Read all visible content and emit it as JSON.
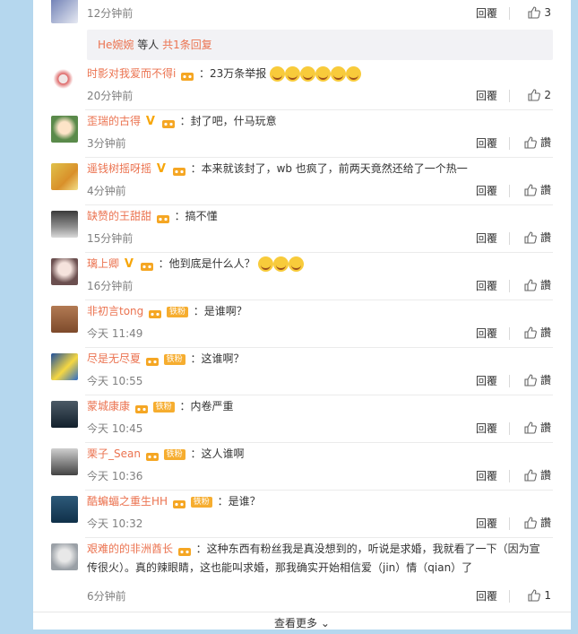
{
  "top_comment": {
    "time": "12分钟前",
    "reply": "回覆",
    "likes": "3"
  },
  "reply_box": {
    "user": "He婉婉",
    "text": " 等人 ",
    "count": "共1条回复"
  },
  "comments": [
    {
      "user": "时影对我爱而不得i",
      "text": "：23万条举报",
      "time": "20分钟前",
      "reply": "回覆",
      "likes": "2",
      "vip": false,
      "fan": false,
      "emojis": 6
    },
    {
      "user": "歪瑞的古得",
      "text": "：封了吧，什马玩意",
      "time": "3分钟前",
      "reply": "回覆",
      "likes": "讚",
      "vip": true,
      "fan": false,
      "emojis": 0
    },
    {
      "user": "遥钱树摇呀摇",
      "text": "：本来就该封了，wb 也疯了，前两天竟然还给了一个热一",
      "time": "4分钟前",
      "reply": "回覆",
      "likes": "讚",
      "vip": true,
      "fan": false,
      "emojis": 0
    },
    {
      "user": "缺赞的王甜甜",
      "text": "：搞不懂",
      "time": "15分钟前",
      "reply": "回覆",
      "likes": "讚",
      "vip": false,
      "fan": false,
      "emojis": 0
    },
    {
      "user": "璃上卿",
      "text": "：他到底是什么人？",
      "time": "16分钟前",
      "reply": "回覆",
      "likes": "讚",
      "vip": true,
      "fan": false,
      "emojis": 3
    },
    {
      "user": "非初言tong",
      "text": "：是谁啊？",
      "time": "今天 11:49",
      "reply": "回覆",
      "likes": "讚",
      "vip": false,
      "fan": true,
      "emojis": 0
    },
    {
      "user": "尽是无尽夏",
      "text": "：这谁啊？",
      "time": "今天 10:55",
      "reply": "回覆",
      "likes": "讚",
      "vip": false,
      "fan": true,
      "emojis": 0
    },
    {
      "user": "蒙城康康",
      "text": "：内卷严重",
      "time": "今天 10:45",
      "reply": "回覆",
      "likes": "讚",
      "vip": false,
      "fan": true,
      "emojis": 0
    },
    {
      "user": "栗子_Sean",
      "text": "：这人谁啊",
      "time": "今天 10:36",
      "reply": "回覆",
      "likes": "讚",
      "vip": false,
      "fan": true,
      "emojis": 0
    },
    {
      "user": "酷蝙蝠之重生HH",
      "text": "：是谁？",
      "time": "今天 10:32",
      "reply": "回覆",
      "likes": "讚",
      "vip": false,
      "fan": true,
      "emojis": 0
    },
    {
      "user": "艰难的的非洲酋长",
      "text": "：这种东西有粉丝我是真没想到的，听说是求婚，我就看了一下（因为宣传很火）。真的辣眼睛，这也能叫求婚，那我确实开始相信爱（jin）情（qian）了",
      "time": "6分钟前",
      "reply": "回覆",
      "likes": "1",
      "vip": false,
      "fan": false,
      "emojis": 0
    }
  ],
  "fan_label": "铁粉",
  "load_more": "查看更多",
  "colors": {
    "username": "#eb7350",
    "background": "#b5d7ee",
    "vip": "#f7a60a"
  }
}
